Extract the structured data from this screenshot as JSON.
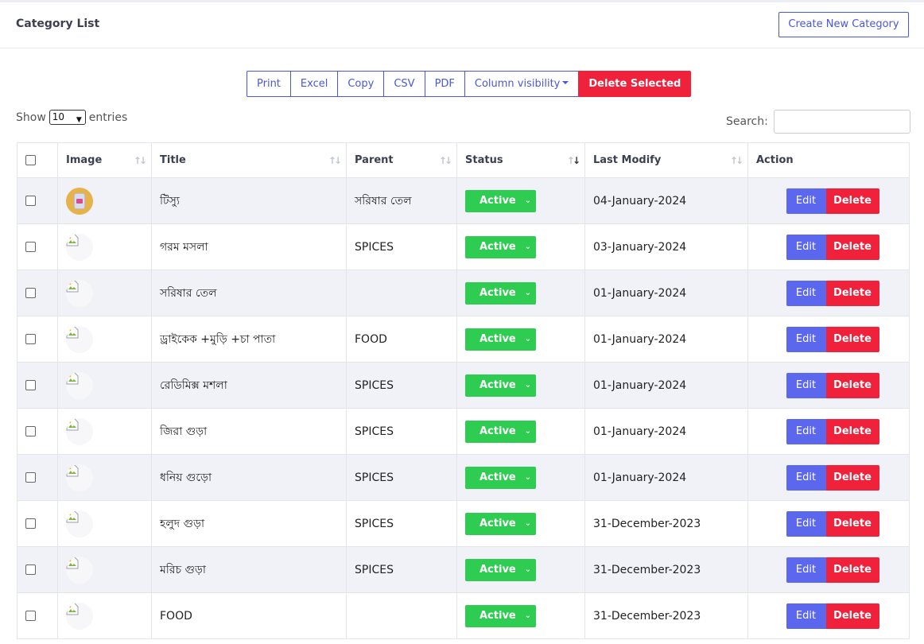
{
  "header": {
    "title": "Category List",
    "create_label": "Create New Category"
  },
  "toolbar": {
    "buttons": [
      "Print",
      "Excel",
      "Copy",
      "CSV",
      "PDF",
      "Column visibility"
    ],
    "delete_selected": "Delete Selected"
  },
  "length": {
    "show": "Show",
    "value": "10",
    "entries": "entries"
  },
  "search": {
    "label": "Search:",
    "value": ""
  },
  "table": {
    "columns": [
      "Image",
      "Title",
      "Parent",
      "Status",
      "Last Modify",
      "Action"
    ],
    "sorted_column": "Status",
    "rows": [
      {
        "title": "টিস্যু",
        "parent": "সরিষার তেল",
        "status": "Active",
        "date": "04-January-2024",
        "image": "photo"
      },
      {
        "title": "গরম মসলা",
        "parent": "SPICES",
        "status": "Active",
        "date": "03-January-2024",
        "image": "broken"
      },
      {
        "title": "সরিষার তেল",
        "parent": "",
        "status": "Active",
        "date": "01-January-2024",
        "image": "broken"
      },
      {
        "title": "ড্রাইকেক +মুড়ি +চা পাতা",
        "parent": "FOOD",
        "status": "Active",
        "date": "01-January-2024",
        "image": "broken"
      },
      {
        "title": "রেডিমিক্স মশলা",
        "parent": "SPICES",
        "status": "Active",
        "date": "01-January-2024",
        "image": "broken"
      },
      {
        "title": "জিরা গুড়া",
        "parent": "SPICES",
        "status": "Active",
        "date": "01-January-2024",
        "image": "broken"
      },
      {
        "title": "ধনিয় গুড়ো",
        "parent": "SPICES",
        "status": "Active",
        "date": "01-January-2024",
        "image": "broken"
      },
      {
        "title": "হলুদ গুড়া",
        "parent": "SPICES",
        "status": "Active",
        "date": "31-December-2023",
        "image": "broken"
      },
      {
        "title": "মরিচ গুড়া",
        "parent": "SPICES",
        "status": "Active",
        "date": "31-December-2023",
        "image": "broken"
      },
      {
        "title": "FOOD",
        "parent": "",
        "status": "Active",
        "date": "31-December-2023",
        "image": "broken"
      }
    ],
    "edit_label": "Edit",
    "delete_label": "Delete"
  },
  "colors": {
    "primary": "#4a57d8",
    "edit": "#5b67ec",
    "danger": "#f0213b",
    "active": "#2ecc50",
    "stripe": "#f1f2f7"
  }
}
